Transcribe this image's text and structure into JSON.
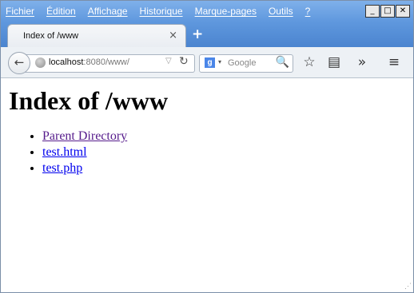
{
  "menu": [
    "Fichier",
    "Édition",
    "Affichage",
    "Historique",
    "Marque-pages",
    "Outils",
    "?"
  ],
  "window_controls": {
    "minimize": "_",
    "maximize": "□",
    "close": "✕"
  },
  "tab": {
    "title": "Index of /www",
    "close_icon": "×"
  },
  "newtab_icon": "+",
  "nav": {
    "back_icon": "←",
    "url_host": "localhost",
    "url_rest": ":8080/www/",
    "dropdown_icon": "▽",
    "reload_icon": "↻"
  },
  "search": {
    "badge": "g",
    "placeholder": "Google",
    "dropdown_icon": "▾",
    "icon": "🔍"
  },
  "toolbar": {
    "bookmark_icon": "☆",
    "reading_icon": "▤",
    "overflow_icon": "»",
    "menu_icon": "≡"
  },
  "page": {
    "heading": "Index of /www",
    "items": [
      "Parent Directory",
      "test.html",
      "test.php"
    ]
  },
  "colors": {
    "visited_link": "#551a8b",
    "link": "#0000ee",
    "titlebar": "#5f98de"
  }
}
